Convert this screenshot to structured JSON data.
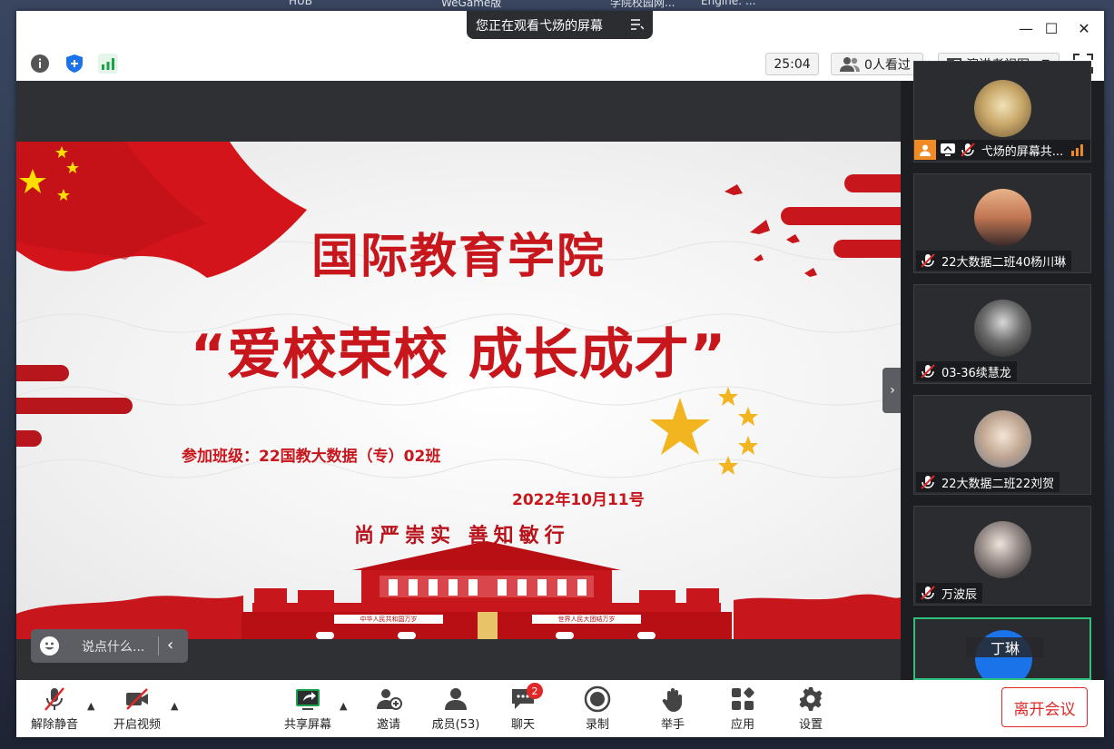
{
  "desktop": {
    "taskbar_fragments": [
      "HUB",
      "WeGame版",
      "学院校园网...",
      "Engine: ..."
    ]
  },
  "window": {
    "sharing_banner": "您正在观看弋炀的屏幕",
    "controls": {
      "minimize": "—",
      "maximize": "☐",
      "close": "✕"
    }
  },
  "infobar": {
    "timer": "25:04",
    "viewers": "0人看过",
    "view_mode": "演讲者视图"
  },
  "slide": {
    "title": "国际教育学院",
    "subtitle": "“爱校荣校 成长成才”",
    "class_line": "参加班级：22国教大数据（专）02班",
    "date": "2022年10月11号",
    "motto": "尚严崇实 善知敏行",
    "gate_banner_left": "中华人民共和国万岁",
    "gate_banner_right": "世界人民大团结万岁"
  },
  "chat_input": {
    "placeholder": "说点什么..."
  },
  "participants": [
    {
      "name": "弋炀的屏幕共...",
      "sharing": true
    },
    {
      "name": "22大数据二班40杨川琳"
    },
    {
      "name": "03-36续慧龙"
    },
    {
      "name": "22大数据二班22刘贺"
    },
    {
      "name": "万波辰"
    },
    {
      "name": "丁琳",
      "active_speaker": true
    }
  ],
  "toolbar": {
    "unmute": "解除静音",
    "start_video": "开启视频",
    "share_screen": "共享屏幕",
    "invite": "邀请",
    "members": "成员(53)",
    "chat": "聊天",
    "chat_badge": "2",
    "record": "录制",
    "raise_hand": "举手",
    "apps": "应用",
    "settings": "设置",
    "leave": "离开会议"
  },
  "colors": {
    "slide_red": "#c8161d",
    "leave_red": "#e02828",
    "active_green": "#2ec27e",
    "dark_stage": "#2f3033"
  }
}
